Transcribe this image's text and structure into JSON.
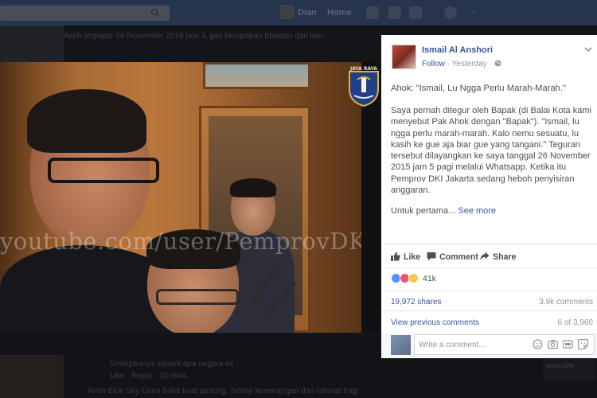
{
  "topbar": {
    "user_name": "Dian",
    "home_label": "Home"
  },
  "background": {
    "top_snippet": "Aceh terpapar 06 November 2016 jam 3, gas berupakan bawaan dan lain...",
    "comment_line_1": "Sedepannya seperti apa negara ini",
    "comment_line_2": "Like · Reply · 10 mins",
    "comment_line_3": "Amin Blue Sky Cinta Sakit buat jantung. Setiap kesenangan dan rahmat bagi",
    "right_label": "available"
  },
  "photo": {
    "watermark": "youtube.com/user/PemprovDKI",
    "emblem_text": "JAYA RAYA"
  },
  "post": {
    "author": "Ismail Al Anshori",
    "follow_label": "Follow",
    "time": "Yesterday",
    "title": "Ahok: \"Ismail, Lu Ngga Perlu Marah-Marah.\"",
    "body": "Saya pernah ditegur oleh Bapak (di Balai Kota kami menyebut Pak Ahok dengan \"Bapak\"). \"Ismail, lu ngga perlu marah-marah. Kalo nemu sesuatu, lu kasih ke gue aja biar gue yang tangani.\" Teguran tersebut dilayangkan ke saya tanggal 26 November 2015 jam 5 pagi melalui Whatsapp. Ketika itu Pemprov DKI Jakarta sedang heboh penyisiran anggaran.",
    "more_text": "Untuk pertama...",
    "see_more": "See more",
    "actions": {
      "like": "Like",
      "comment": "Comment",
      "share": "Share"
    },
    "reaction_count": "41k",
    "shares": "19,972 shares",
    "comments_count": "3.9k comments",
    "view_previous": "View previous comments",
    "page_count": "6 of 3,960",
    "comment_placeholder": "Write a comment..."
  },
  "colors": {
    "link": "#365899",
    "like_blue": "#5890ff",
    "love_red": "#f25268",
    "haha_yellow": "#f7c64a"
  }
}
